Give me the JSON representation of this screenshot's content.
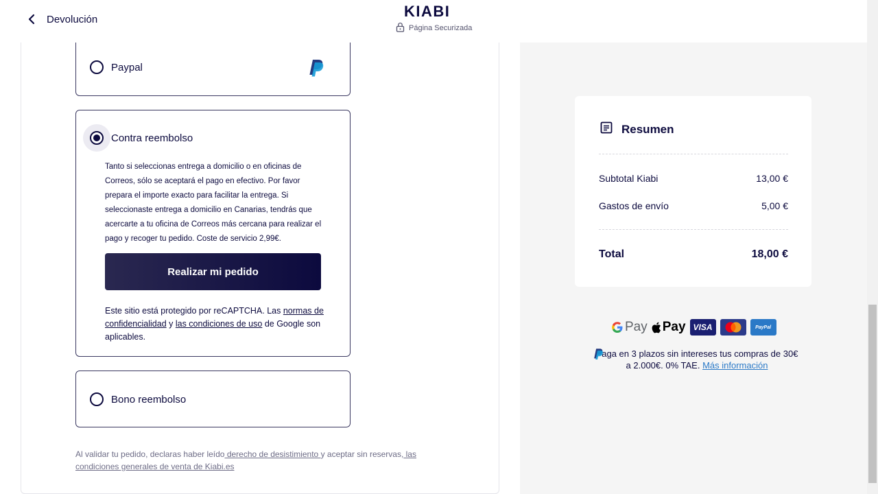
{
  "header": {
    "back_label": "Devolución",
    "logo": "KIABI",
    "secure_label": "Página Securizada"
  },
  "payment_methods": {
    "paypal": {
      "label": "Paypal",
      "selected": false
    },
    "cod": {
      "label": "Contra reembolso",
      "selected": true,
      "description": "Tanto si seleccionas entrega a domicilio o en oficinas de Correos, sólo se aceptará el pago en efectivo. Por favor prepara el importe exacto para facilitar la entrega. Si seleccionaste entrega a domicilio en Canarias, tendrás que acercarte a tu oficina de Correos más cercana para realizar el pago y recoger tu pedido. Coste de servicio 2,99€.",
      "order_button": "Realizar mi pedido",
      "recaptcha_prefix": "Este sitio está protegido por reCAPTCHA. Las ",
      "recaptcha_link1": "normas de confidencialidad",
      "recaptcha_mid": " y ",
      "recaptcha_link2": "las condiciones de uso",
      "recaptcha_suffix": " de Google son aplicables."
    },
    "bono": {
      "label": "Bono reembolso",
      "selected": false
    }
  },
  "legal": {
    "prefix": "Al validar tu pedido, declaras haber leído",
    "link1": " derecho de desistimiento ",
    "mid": "y aceptar sin reservas,",
    "link2": " las condiciones generales de venta de Kiabi.es"
  },
  "summary": {
    "title": "Resumen",
    "rows": [
      {
        "label": "Subtotal Kiabi",
        "value": "13,00 €"
      },
      {
        "label": "Gastos de envío",
        "value": "5,00 €"
      }
    ],
    "total_label": "Total",
    "total_value": "18,00 €"
  },
  "payment_badges": {
    "gpay": "Pay",
    "apay": "Pay",
    "visa": "VISA",
    "paypal_badge": "PayPal"
  },
  "installments": {
    "text": "Paga en 3 plazos sin intereses tus compras de 30€ a 2.000€. 0% TAE. ",
    "link": "Más información"
  },
  "colors": {
    "brand_dark": "#0c0a3e",
    "link_blue": "#2a79c7",
    "panel_bg": "#f5f5f5"
  }
}
